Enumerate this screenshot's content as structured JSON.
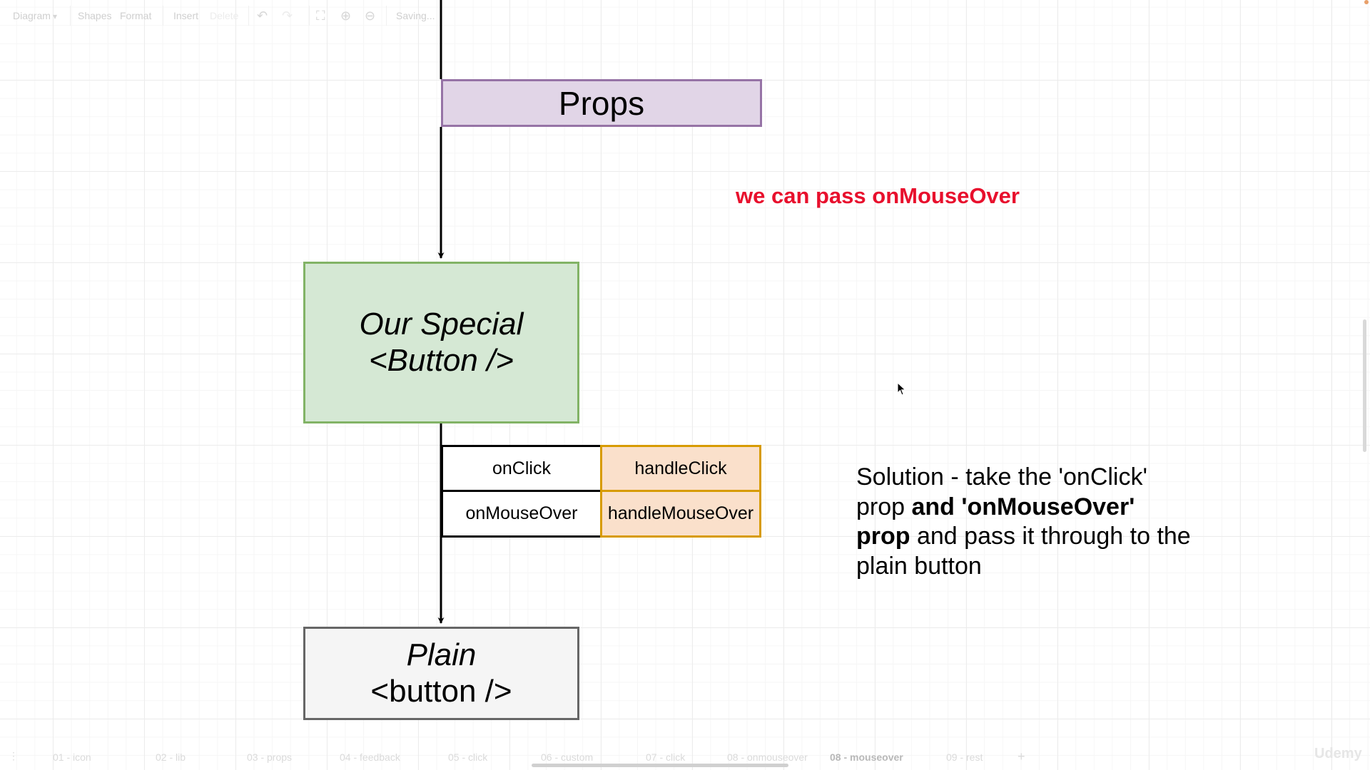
{
  "toolbar": {
    "diagram": "Diagram",
    "shapes": "Shapes",
    "format": "Format",
    "insert": "Insert",
    "delete": "Delete",
    "status": "Saving..."
  },
  "diagram": {
    "props": "Props",
    "special_line1": "Our Special",
    "special_line2": "<Button />",
    "onclick": "onClick",
    "handleclick": "handleClick",
    "onmouseover": "onMouseOver",
    "handlemouseover": "handleMouseOver",
    "plain_line1": "Plain",
    "plain_line2": "<button />"
  },
  "note": "we can pass onMouseOver",
  "solution": {
    "p1": "Solution - take the 'onClick' prop ",
    "b1": "and 'onMouseOver' prop",
    "p2": " and pass it through to the plain button"
  },
  "tabs": [
    "01 - icon",
    "02 - lib",
    "03 - props",
    "04 - feedback",
    "05 - click",
    "06 - custom",
    "07 - click",
    "08 - onmouseover",
    "08 - mouseover",
    "09 - rest"
  ],
  "active_tab": "08 - mouseover",
  "watermark": "Udemy",
  "colors": {
    "props_fill": "#e1d5e7",
    "props_stroke": "#9673a6",
    "special_fill": "#d5e8d4",
    "special_stroke": "#82b366",
    "plain_fill": "#f5f5f5",
    "plain_stroke": "#666666",
    "handler_fill": "#fae0cb",
    "handler_stroke": "#d79b00",
    "note": "#e8102d"
  }
}
